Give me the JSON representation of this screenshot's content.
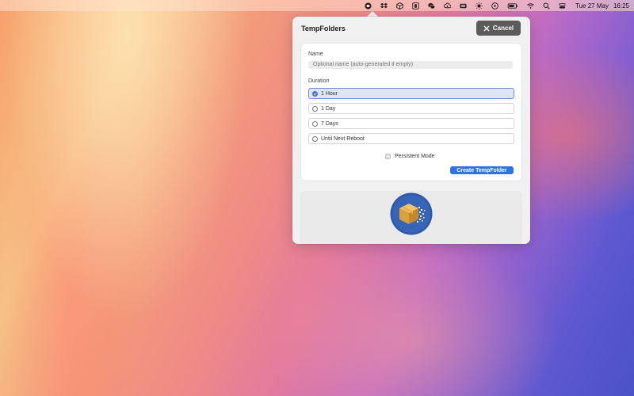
{
  "menubar": {
    "date": "Tue 27 May",
    "time": "16:25",
    "icons": [
      "tempfolders-icon",
      "dropbox-icon",
      "package-icon",
      "app-square-icon",
      "wechat-icon",
      "cloud-drive-icon",
      "keyboard-icon",
      "sun-icon",
      "play-icon",
      "battery-icon",
      "wifi-icon",
      "search-icon",
      "control-center-icon"
    ]
  },
  "popover": {
    "title": "TempFolders",
    "cancel_label": "Cancel",
    "name_label": "Name",
    "name_placeholder": "Optional name (auto-generated if empty)",
    "duration_label": "Duration",
    "options": [
      {
        "label": "1 Hour",
        "selected": true
      },
      {
        "label": "1 Day",
        "selected": false
      },
      {
        "label": "7 Days",
        "selected": false
      },
      {
        "label": "Until Next Reboot",
        "selected": false
      }
    ],
    "persistent_label": "Persistent Mode",
    "persistent_checked": false,
    "create_label": "Create TempFolder"
  },
  "colors": {
    "accent": "#2e73e2",
    "cancel_bg": "#5b5b5b",
    "selected_bg": "#dfe5f6"
  }
}
